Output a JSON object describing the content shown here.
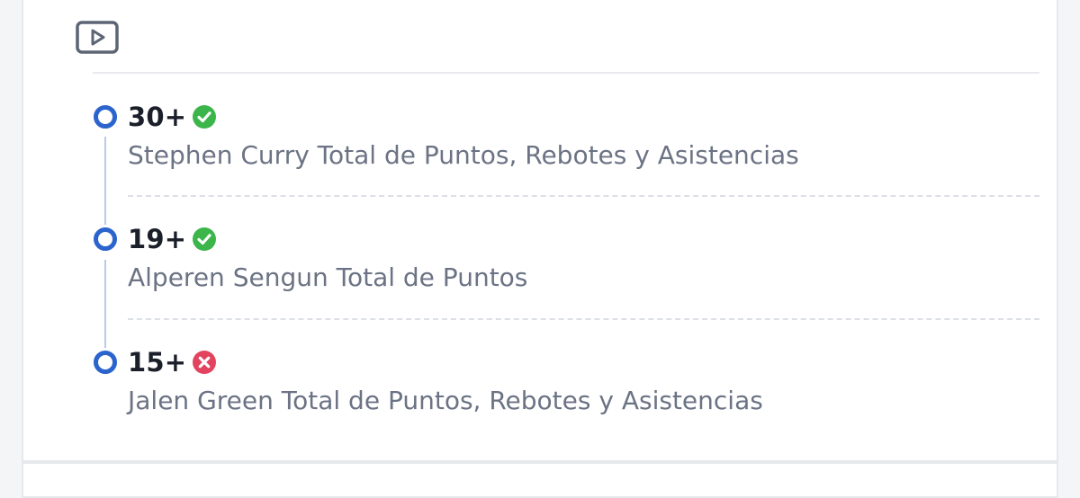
{
  "colors": {
    "marker": "#2a64cc",
    "won": "#3cb54a",
    "lost": "#e2435f",
    "value_text": "#1b1f2a",
    "desc_text": "#6b7384"
  },
  "header": {
    "icon": "play-video-icon"
  },
  "legs": [
    {
      "value": "30+",
      "status": "won",
      "status_icon": "check-circle-icon",
      "description": "Stephen Curry Total de Puntos, Rebotes y Asistencias"
    },
    {
      "value": "19+",
      "status": "won",
      "status_icon": "check-circle-icon",
      "description": "Alperen Sengun Total de Puntos"
    },
    {
      "value": "15+",
      "status": "lost",
      "status_icon": "x-circle-icon",
      "description": "Jalen Green Total de Puntos, Rebotes y Asistencias"
    }
  ]
}
